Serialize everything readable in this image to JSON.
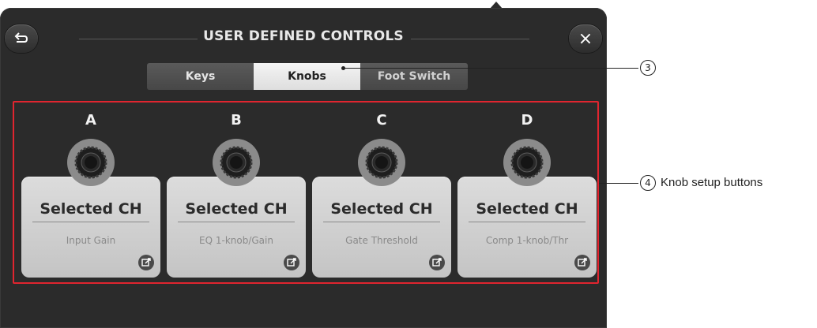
{
  "window": {
    "title": "USER DEFINED CONTROLS",
    "back_icon": "back-arrow-icon",
    "close_label": "×"
  },
  "tabs": [
    {
      "label": "Keys",
      "active": false
    },
    {
      "label": "Knobs",
      "active": true
    },
    {
      "label": "Foot Switch",
      "active": false
    }
  ],
  "knobs": [
    {
      "letter": "A",
      "target": "Selected CH",
      "param": "Input Gain"
    },
    {
      "letter": "B",
      "target": "Selected CH",
      "param": "EQ 1-knob/Gain"
    },
    {
      "letter": "C",
      "target": "Selected CH",
      "param": "Gate Threshold"
    },
    {
      "letter": "D",
      "target": "Selected CH",
      "param": "Comp 1-knob/Thr"
    }
  ],
  "callouts": {
    "tabs_number": "3",
    "knobs_number": "4",
    "knobs_label": "Knob setup buttons"
  },
  "colors": {
    "panel": "#2b2b2b",
    "highlight_frame": "#e0252f",
    "card": "#d4d4d4"
  }
}
